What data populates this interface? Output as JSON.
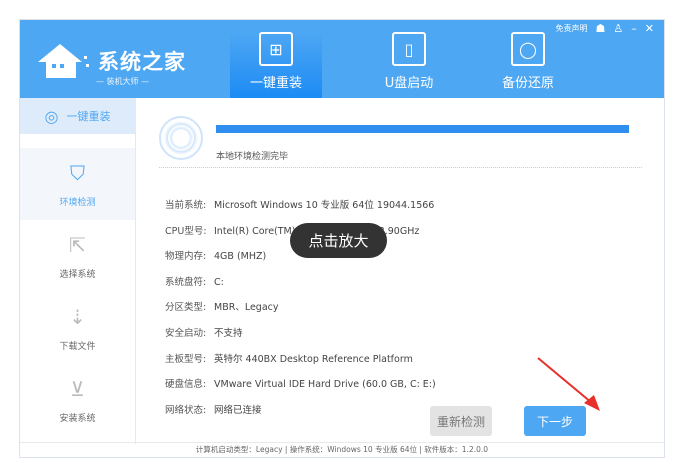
{
  "header": {
    "logo_title": "系统之家",
    "logo_subtitle": "— 装机大师 —",
    "disclaimer": "免责声明",
    "tabs": [
      {
        "label": "一键重装",
        "icon": "windows-monitor-icon"
      },
      {
        "label": "U盘启动",
        "icon": "usb-icon"
      },
      {
        "label": "备份还原",
        "icon": "backup-monitor-icon"
      }
    ]
  },
  "sidebar": {
    "top": "一键重装",
    "items": [
      {
        "label": "环境检测"
      },
      {
        "label": "选择系统"
      },
      {
        "label": "下载文件"
      },
      {
        "label": "安装系统"
      }
    ]
  },
  "main": {
    "progress": 100,
    "status": "本地环境检测完毕",
    "rows": [
      {
        "k": "当前系统:",
        "v": "Microsoft Windows 10 专业版 64位 19044.1566"
      },
      {
        "k": "CPU型号:",
        "v": "Intel(R) Core(TM) i7-10700 CPU @ 2.90GHz"
      },
      {
        "k": "物理内存:",
        "v": "4GB (MHZ)"
      },
      {
        "k": "系统盘符:",
        "v": "C:"
      },
      {
        "k": "分区类型:",
        "v": "MBR、Legacy"
      },
      {
        "k": "安全启动:",
        "v": "不支持"
      },
      {
        "k": "主板型号:",
        "v": "英特尔 440BX Desktop Reference Platform"
      },
      {
        "k": "硬盘信息:",
        "v": "VMware Virtual IDE Hard Drive  (60.0 GB, C: E:)"
      },
      {
        "k": "网络状态:",
        "v": "网络已连接"
      }
    ],
    "recheck": "重新检测",
    "next": "下一步"
  },
  "footer": "计算机启动类型：Legacy | 操作系统：Windows 10 专业版 64位 | 软件版本：1.2.0.0",
  "tooltip": "点击放大"
}
